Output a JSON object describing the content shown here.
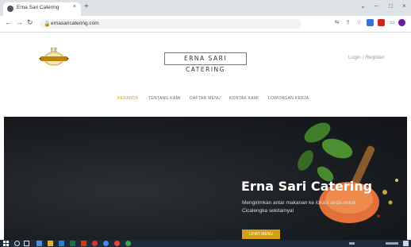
{
  "browser": {
    "tab_title": "Erna Sari Catering",
    "tab_close": "×",
    "new_tab": "+",
    "url": "ernasaricatering.com",
    "window_controls": [
      "⌄",
      "–",
      "□",
      "×"
    ]
  },
  "site": {
    "brand": "ERNA SARI CATERING",
    "logo_initials": "EE",
    "login": "Login / Register",
    "menu": [
      "BERANDA",
      "TENTANG KAMI",
      "DAFTAR MENU",
      "KONTAK KAMI",
      "LOWONGAN KERJA"
    ],
    "hero": {
      "title": "Erna Sari Catering",
      "description": "Mengirimkan antar makanan ke lokasi anda untuk Cicalengka sekitarnya!",
      "button": "LIHAT MENU"
    }
  },
  "colors": {
    "accent": "#d4a017",
    "hero_bg": "#1a1d21",
    "taskbar": "#1c2a3a"
  }
}
